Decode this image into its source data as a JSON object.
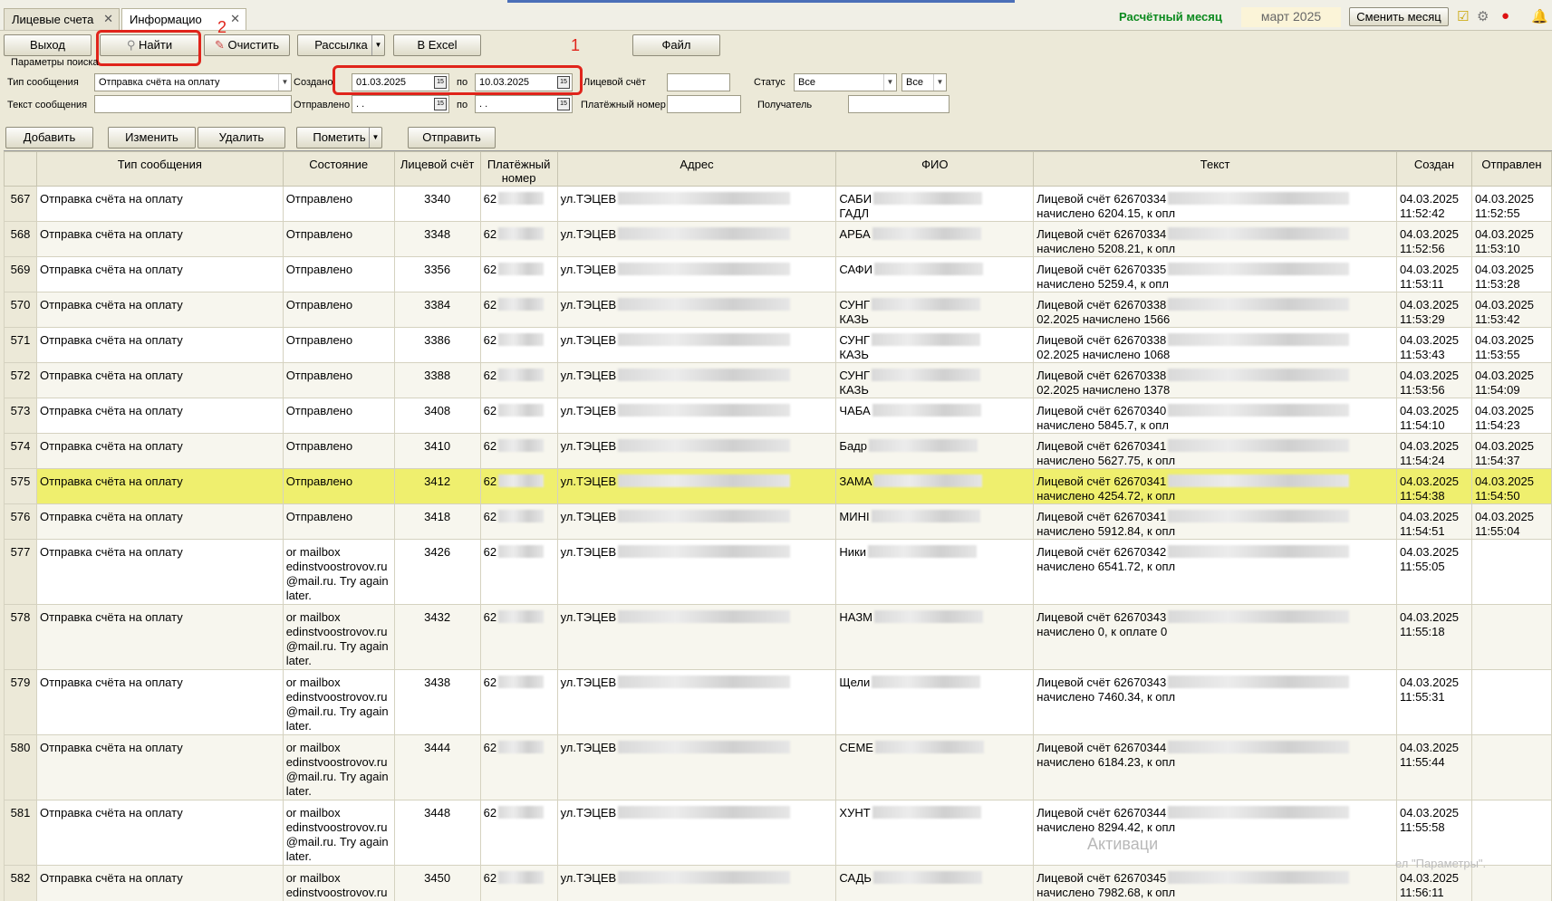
{
  "tabs": [
    {
      "label": "Лицевые счета"
    },
    {
      "label": "Информацио"
    }
  ],
  "header": {
    "month_label": "Расчётный месяц",
    "month_value": "март 2025",
    "change_month_label": "Сменить месяц"
  },
  "toolbar": {
    "exit_label": "Выход",
    "find_label": "Найти",
    "clear_label": "Очистить",
    "mailing_label": "Рассылка",
    "excel_label": "В Excel",
    "file_label": "Файл"
  },
  "annotations": {
    "one": "1",
    "two": "2"
  },
  "params": {
    "title": "Параметры поиска",
    "msg_type_label": "Тип сообщения",
    "msg_type_value": "Отправка счёта на оплату",
    "created_label": "Создано",
    "created_from": "01.03.2025",
    "to_label": "по",
    "created_to": "10.03.2025",
    "account_label": "Лицевой счёт",
    "status_label": "Статус",
    "status_value": "Все",
    "status_value2": "Все",
    "msg_text_label": "Текст сообщения",
    "sent_label": "Отправлено",
    "sent_from": " .  .",
    "sent_to": " .  .",
    "payment_label": "Платёжный номер",
    "recipient_label": "Получатель"
  },
  "actions": {
    "add_label": "Добавить",
    "edit_label": "Изменить",
    "delete_label": "Удалить",
    "mark_label": "Пометить",
    "send_label": "Отправить"
  },
  "columns": {
    "type": "Тип сообщения",
    "state": "Состояние",
    "account": "Лицевой счёт",
    "payment_1": "Платёжный",
    "payment_2": "номер",
    "address": "Адрес",
    "fio": "ФИО",
    "text": "Текст",
    "created": "Создан",
    "sent": "Отправлен"
  },
  "rows": [
    {
      "n": "567",
      "type": "Отправка счёта на оплату",
      "state": "Отправлено",
      "acc": "3340",
      "pay": "62",
      "addr": "ул.ТЭЦЕВ",
      "fio1": "САБИ",
      "fio2": "ГАДЛ",
      "t1": "Лицевой счёт 62670334",
      "t2": "начислено 6204.15, к опл",
      "c1": "04.03.2025",
      "c2": "11:52:42",
      "s1": "04.03.2025",
      "s2": "11:52:55"
    },
    {
      "n": "568",
      "type": "Отправка счёта на оплату",
      "state": "Отправлено",
      "acc": "3348",
      "pay": "62",
      "addr": "ул.ТЭЦЕВ",
      "fio1": "АРБА",
      "fio2": "",
      "t1": "Лицевой счёт 62670334",
      "t2": "начислено 5208.21, к опл",
      "c1": "04.03.2025",
      "c2": "11:52:56",
      "s1": "04.03.2025",
      "s2": "11:53:10"
    },
    {
      "n": "569",
      "type": "Отправка счёта на оплату",
      "state": "Отправлено",
      "acc": "3356",
      "pay": "62",
      "addr": "ул.ТЭЦЕВ",
      "fio1": "САФИ",
      "fio2": "",
      "t1": "Лицевой счёт 62670335",
      "t2": "начислено 5259.4, к опл",
      "c1": "04.03.2025",
      "c2": "11:53:11",
      "s1": "04.03.2025",
      "s2": "11:53:28"
    },
    {
      "n": "570",
      "type": "Отправка счёта на оплату",
      "state": "Отправлено",
      "acc": "3384",
      "pay": "62",
      "addr": "ул.ТЭЦЕВ",
      "fio1": "СУНГ",
      "fio2": "КАЗЬ",
      "t1": "Лицевой счёт 62670338",
      "t2": "02.2025 начислено 1566",
      "c1": "04.03.2025",
      "c2": "11:53:29",
      "s1": "04.03.2025",
      "s2": "11:53:42"
    },
    {
      "n": "571",
      "type": "Отправка счёта на оплату",
      "state": "Отправлено",
      "acc": "3386",
      "pay": "62",
      "addr": "ул.ТЭЦЕВ",
      "fio1": "СУНГ",
      "fio2": "КАЗЬ",
      "t1": "Лицевой счёт 62670338",
      "t2": "02.2025 начислено 1068",
      "c1": "04.03.2025",
      "c2": "11:53:43",
      "s1": "04.03.2025",
      "s2": "11:53:55"
    },
    {
      "n": "572",
      "type": "Отправка счёта на оплату",
      "state": "Отправлено",
      "acc": "3388",
      "pay": "62",
      "addr": "ул.ТЭЦЕВ",
      "fio1": "СУНГ",
      "fio2": "КАЗЬ",
      "t1": "Лицевой счёт 62670338",
      "t2": "02.2025 начислено 1378",
      "c1": "04.03.2025",
      "c2": "11:53:56",
      "s1": "04.03.2025",
      "s2": "11:54:09"
    },
    {
      "n": "573",
      "type": "Отправка счёта на оплату",
      "state": "Отправлено",
      "acc": "3408",
      "pay": "62",
      "addr": "ул.ТЭЦЕВ",
      "fio1": "ЧАБА",
      "fio2": "",
      "t1": "Лицевой счёт 62670340",
      "t2": "начислено 5845.7, к опл",
      "c1": "04.03.2025",
      "c2": "11:54:10",
      "s1": "04.03.2025",
      "s2": "11:54:23"
    },
    {
      "n": "574",
      "type": "Отправка счёта на оплату",
      "state": "Отправлено",
      "acc": "3410",
      "pay": "62",
      "addr": "ул.ТЭЦЕВ",
      "fio1": "Бадр",
      "fio2": "",
      "t1": "Лицевой счёт 62670341",
      "t2": "начислено 5627.75, к опл",
      "c1": "04.03.2025",
      "c2": "11:54:24",
      "s1": "04.03.2025",
      "s2": "11:54:37"
    },
    {
      "n": "575",
      "type": "Отправка счёта на оплату",
      "state": "Отправлено",
      "acc": "3412",
      "pay": "62",
      "addr": "ул.ТЭЦЕВ",
      "fio1": "ЗАМА",
      "fio2": "",
      "t1": "Лицевой счёт 62670341",
      "t2": "начислено 4254.72, к опл",
      "c1": "04.03.2025",
      "c2": "11:54:38",
      "s1": "04.03.2025",
      "s2": "11:54:50"
    },
    {
      "n": "576",
      "type": "Отправка счёта на оплату",
      "state": "Отправлено",
      "acc": "3418",
      "pay": "62",
      "addr": "ул.ТЭЦЕВ",
      "fio1": "МИНІ",
      "fio2": "",
      "t1": "Лицевой счёт 62670341",
      "t2": "начислено 5912.84, к опл",
      "c1": "04.03.2025",
      "c2": "11:54:51",
      "s1": "04.03.2025",
      "s2": "11:55:04"
    },
    {
      "n": "577",
      "type": "Отправка счёта на оплату",
      "state": "or mailbox edinstvoostrovov.ru @mail.ru. Try again later.",
      "acc": "3426",
      "pay": "62",
      "addr": "ул.ТЭЦЕВ",
      "fio1": "Ники",
      "fio2": "",
      "t1": "Лицевой счёт 62670342",
      "t2": "начислено 6541.72, к опл",
      "c1": "04.03.2025",
      "c2": "11:55:05",
      "s1": "",
      "s2": ""
    },
    {
      "n": "578",
      "type": "Отправка счёта на оплату",
      "state": "or mailbox edinstvoostrovov.ru @mail.ru. Try again later.",
      "acc": "3432",
      "pay": "62",
      "addr": "ул.ТЭЦЕВ",
      "fio1": "НАЗМ",
      "fio2": "",
      "t1": "Лицевой счёт 62670343",
      "t2": "начислено 0, к оплате 0",
      "c1": "04.03.2025",
      "c2": "11:55:18",
      "s1": "",
      "s2": ""
    },
    {
      "n": "579",
      "type": "Отправка счёта на оплату",
      "state": "or mailbox edinstvoostrovov.ru @mail.ru. Try again later.",
      "acc": "3438",
      "pay": "62",
      "addr": "ул.ТЭЦЕВ",
      "fio1": "Щели",
      "fio2": "",
      "t1": "Лицевой счёт 62670343",
      "t2": "начислено 7460.34, к опл",
      "c1": "04.03.2025",
      "c2": "11:55:31",
      "s1": "",
      "s2": ""
    },
    {
      "n": "580",
      "type": "Отправка счёта на оплату",
      "state": "or mailbox edinstvoostrovov.ru @mail.ru. Try again later.",
      "acc": "3444",
      "pay": "62",
      "addr": "ул.ТЭЦЕВ",
      "fio1": "СЕМЕ",
      "fio2": "",
      "t1": "Лицевой счёт 62670344",
      "t2": "начислено 6184.23, к опл",
      "c1": "04.03.2025",
      "c2": "11:55:44",
      "s1": "",
      "s2": ""
    },
    {
      "n": "581",
      "type": "Отправка счёта на оплату",
      "state": "or mailbox edinstvoostrovov.ru @mail.ru. Try again later.",
      "acc": "3448",
      "pay": "62",
      "addr": "ул.ТЭЦЕВ",
      "fio1": "ХУНТ",
      "fio2": "",
      "t1": "Лицевой счёт 62670344",
      "t2": "начислено 8294.42, к опл",
      "c1": "04.03.2025",
      "c2": "11:55:58",
      "s1": "",
      "s2": ""
    },
    {
      "n": "582",
      "type": "Отправка счёта на оплату",
      "state": "or mailbox edinstvoostrovov.ru @mail.ru. Try again",
      "acc": "3450",
      "pay": "62",
      "addr": "ул.ТЭЦЕВ",
      "fio1": "САДЬ",
      "fio2": "",
      "t1": "Лицевой счёт 62670345",
      "t2": "начислено 7982.68, к опл",
      "c1": "04.03.2025",
      "c2": "11:56:11",
      "s1": "",
      "s2": ""
    }
  ],
  "watermark": {
    "line1": "Активаци",
    "line2": "ел \"Параметры\"."
  }
}
